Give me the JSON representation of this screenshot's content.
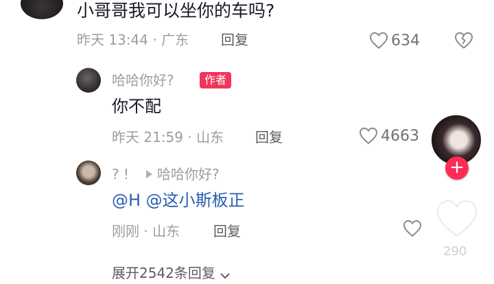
{
  "comment1": {
    "text": "小哥哥我可以坐你的车吗?",
    "meta": "昨天 13:44 · 广东",
    "reply_label": "回复",
    "like_count": "634"
  },
  "comment2": {
    "username": "哈哈你好?",
    "badge": "作者",
    "text": "你不配",
    "meta": "昨天 21:59 · 山东",
    "reply_label": "回复",
    "like_count": "4663"
  },
  "comment3": {
    "username": "? !",
    "reply_to": "哈哈你好?",
    "text": "@H @这小斯板正",
    "meta": "刚刚 · 山东",
    "reply_label": "回复"
  },
  "expand_label": "展开2542条回复",
  "side": {
    "like_count": "290"
  },
  "colors": {
    "accent": "#fe2c55",
    "badge": "#f0365a",
    "mention": "#2a5fb0"
  }
}
